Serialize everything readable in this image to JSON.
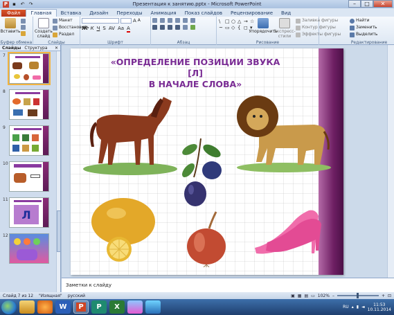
{
  "window": {
    "title": "Презентация к занятию.pptx - Microsoft PowerPoint"
  },
  "tabs": [
    "Файл",
    "Главная",
    "Вставка",
    "Дизайн",
    "Переходы",
    "Анимация",
    "Показ слайдов",
    "Рецензирование",
    "Вид"
  ],
  "ribbon": {
    "clipboard": {
      "paste": "Вставить",
      "label": "Буфер обмена"
    },
    "slides": {
      "new_slide": "Создать слайд",
      "layout": "Макет",
      "reset": "Восстановить",
      "section": "Раздел",
      "label": "Слайды"
    },
    "font": {
      "label": "Шрифт"
    },
    "paragraph": {
      "label": "Абзац"
    },
    "drawing": {
      "arrange": "Упорядочить",
      "quick_styles": "Экспресс-стили",
      "fill": "Заливка фигуры",
      "outline": "Контур фигуры",
      "effects": "Эффекты фигуры",
      "label": "Рисование"
    },
    "editing": {
      "find": "Найти",
      "replace": "Заменить",
      "select": "Выделить",
      "label": "Редактирование"
    }
  },
  "slides_pane": {
    "tab_slides": "Слайды",
    "tab_outline": "Структура",
    "thumbnails": [
      {
        "num": "7",
        "selected": true
      },
      {
        "num": "8",
        "selected": false
      },
      {
        "num": "9",
        "selected": false
      },
      {
        "num": "10",
        "selected": false
      },
      {
        "num": "11",
        "selected": false,
        "letter": "Л"
      },
      {
        "num": "12",
        "selected": false
      }
    ]
  },
  "slide": {
    "title_line1": "«ОПРЕДЕЛЕНИЕ ПОЗИЦИИ ЗВУКА [Л]",
    "title_line2": "В НАЧАЛЕ СЛОВА»",
    "images": [
      "horse",
      "lion",
      "plum",
      "lemon",
      "onion",
      "shoes"
    ]
  },
  "notes": {
    "placeholder": "Заметки к слайду"
  },
  "status": {
    "slide_info": "Слайд 7 из 12",
    "theme": "\"Изящная\"",
    "language": "русский",
    "zoom": "102%"
  },
  "taskbar": {
    "lang": "RU",
    "time": "11:53",
    "date": "10.11.2014"
  }
}
